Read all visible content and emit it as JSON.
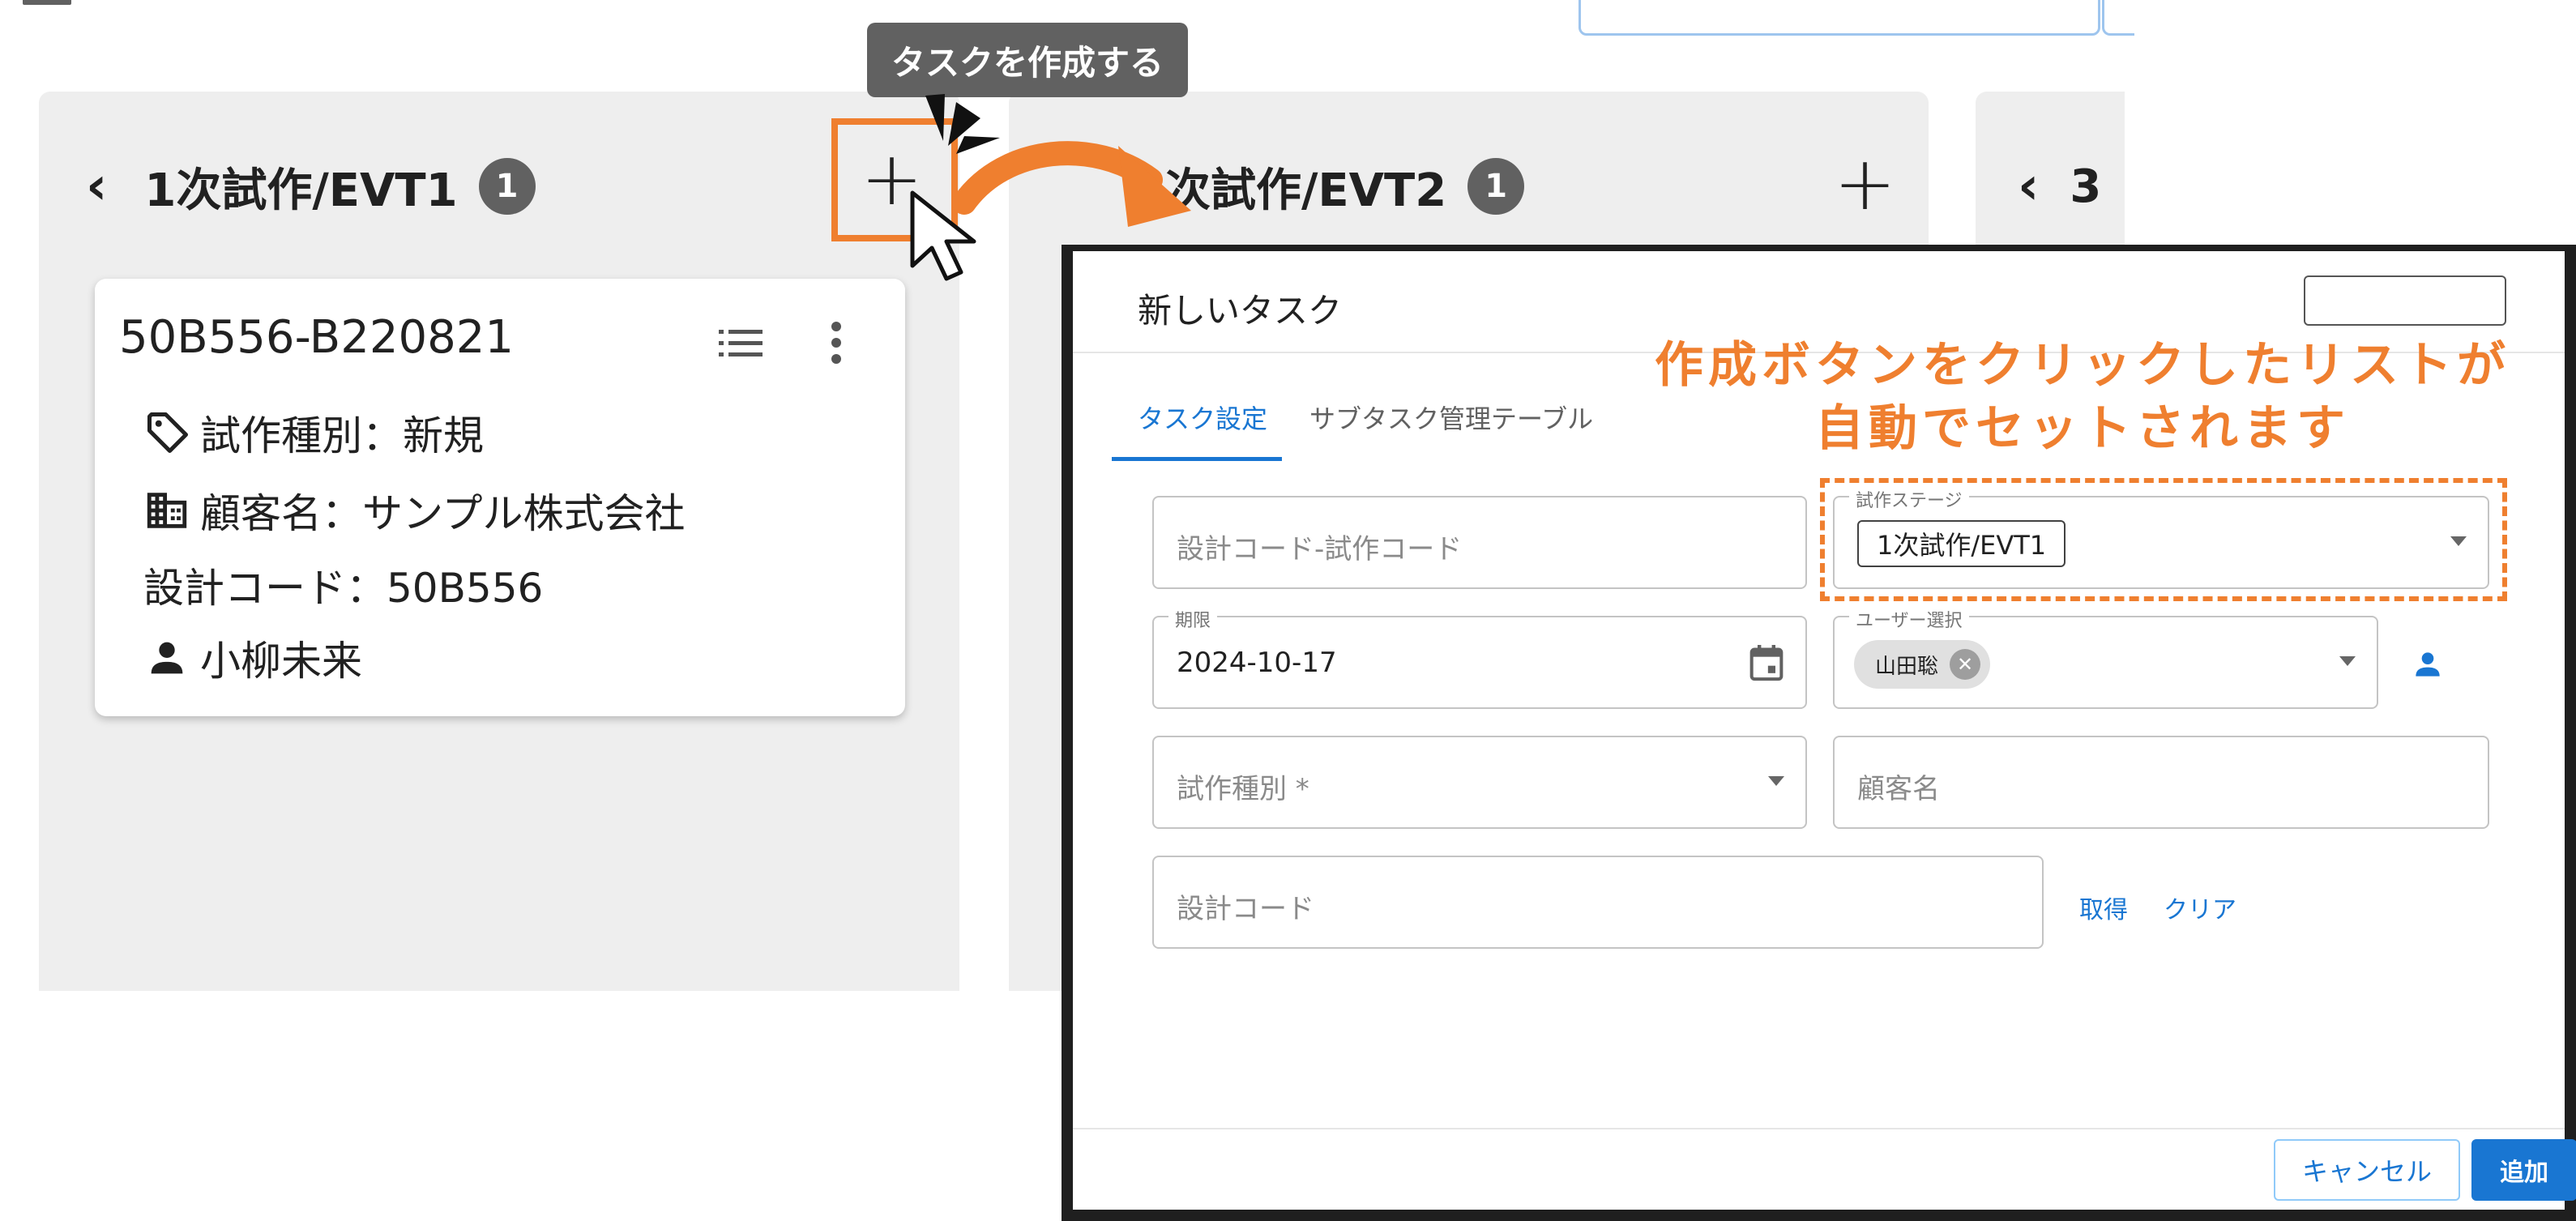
{
  "tooltip": {
    "text": "タスクを作成する"
  },
  "columns": [
    {
      "title": "1次試作/EVT1",
      "count": "1"
    },
    {
      "title": "2次試作/EVT2",
      "count": "1"
    },
    {
      "title": "3"
    }
  ],
  "card": {
    "id": "50B556-B220821",
    "type_line": "試作種別：新規",
    "customer_line": "顧客名：サンプル株式会社",
    "design_code_line": "設計コード：50B556",
    "assignee": "小柳未来"
  },
  "dialog": {
    "title": "新しいタスク",
    "tabs": [
      {
        "label": "タスク設定",
        "active": true
      },
      {
        "label": "サブタスク管理テーブル",
        "active": false
      }
    ],
    "fields": {
      "code": {
        "placeholder": "設計コード-試作コード"
      },
      "stage": {
        "legend": "試作ステージ",
        "value": "1次試作/EVT1"
      },
      "deadline": {
        "legend": "期限",
        "value": "2024-10-17"
      },
      "user": {
        "legend": "ユーザー選択",
        "chip": "山田聡"
      },
      "type": {
        "placeholder": "試作種別 *"
      },
      "customer": {
        "placeholder": "顧客名"
      },
      "design_code": {
        "placeholder": "設計コード"
      }
    },
    "links": {
      "fetch": "取得",
      "clear": "クリア"
    },
    "buttons": {
      "cancel": "キャンセル",
      "add": "追加"
    }
  },
  "annotation": {
    "line1": "作成ボタンをクリックしたリストが",
    "line2": "自動でセットされます"
  },
  "colors": {
    "accent": "#ef7f2f",
    "primary": "#1976d2",
    "column_bg": "#eeeeee",
    "badge": "#616161"
  }
}
